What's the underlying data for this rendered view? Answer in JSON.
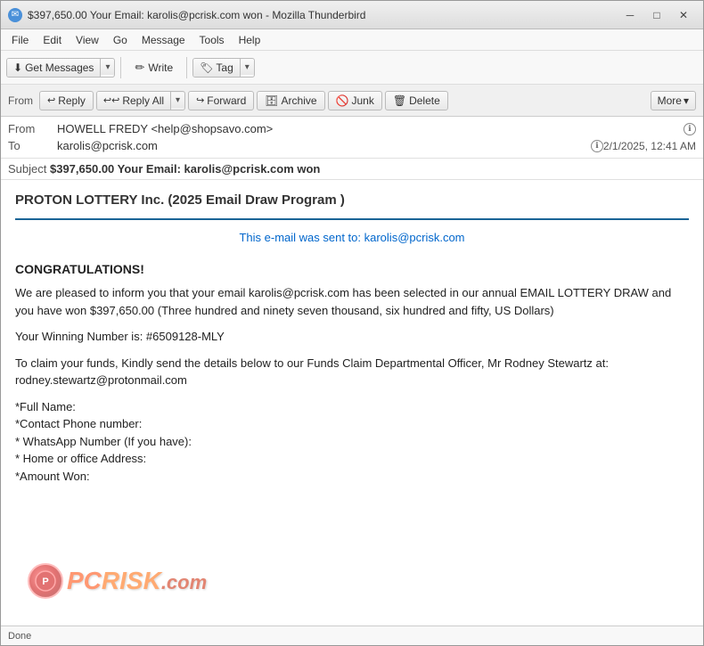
{
  "window": {
    "title": "$397,650.00 Your Email: karolis@pcrisk.com won - Mozilla Thunderbird",
    "controls": {
      "minimize": "─",
      "maximize": "□",
      "close": "✕"
    }
  },
  "menu": {
    "items": [
      "File",
      "Edit",
      "View",
      "Go",
      "Message",
      "Tools",
      "Help"
    ]
  },
  "toolbar": {
    "get_messages_label": "Get Messages",
    "write_label": "Write",
    "tag_label": "Tag"
  },
  "action_bar": {
    "from_label": "From",
    "reply_label": "Reply",
    "reply_all_label": "Reply All",
    "forward_label": "Forward",
    "archive_label": "Archive",
    "junk_label": "Junk",
    "delete_label": "Delete",
    "more_label": "More"
  },
  "email": {
    "from_value": "HOWELL FREDY <help@shopsavo.com>",
    "to_value": "karolis@pcrisk.com",
    "date_value": "2/1/2025, 12:41 AM",
    "subject_label": "Subject",
    "subject_value": "$397,650.00 Your Email: karolis@pcrisk.com won"
  },
  "body": {
    "lottery_header": "PROTON LOTTERY Inc. (2025 Email Draw Program )",
    "sent_to_line": "This e-mail was sent to: karolis@pcrisk.com",
    "congratulations": "CONGRATULATIONS!",
    "paragraph1": "We are pleased to inform you that your email karolis@pcrisk.com has been selected in our annual EMAIL LOTTERY DRAW and you have won $397,650.00 (Three hundred and ninety seven thousand, six hundred and fifty, US Dollars)",
    "paragraph2": "Your Winning Number is: #6509128-MLY",
    "paragraph3": "To claim your funds, Kindly send the details below to our Funds Claim Departmental Officer, Mr Rodney Stewartz at: rodney.stewartz@protonmail.com",
    "fields": [
      "*Full Name:",
      "*Contact Phone number:",
      "* WhatsApp Number (If you have):",
      "* Home or office Address:",
      "*Amount Won:"
    ]
  },
  "status": {
    "text": "Done"
  },
  "watermark": {
    "icon_text": "P",
    "text_part1": "PC",
    "text_part2": "RISK",
    "text_suffix": ".com"
  }
}
